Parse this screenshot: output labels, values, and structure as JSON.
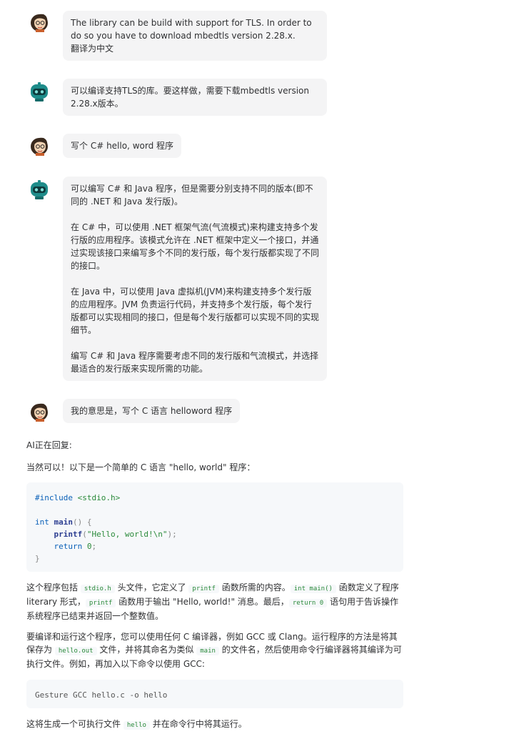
{
  "messages": [
    {
      "role": "user",
      "lines": [
        "The library can be build with support for TLS. In order to do so you have to download mbedtls version 2.28.x.",
        "翻译为中文"
      ]
    },
    {
      "role": "ai",
      "lines": [
        "可以编译支持TLS的库。要这样做，需要下载mbedtls version 2.28.x版本。"
      ]
    },
    {
      "role": "user",
      "lines": [
        "写个 C# hello, word 程序"
      ]
    },
    {
      "role": "ai",
      "paragraphs": [
        "可以编写 C# 和 Java 程序，但是需要分别支持不同的版本(即不同的 .NET 和 Java 发行版)。",
        "在 C# 中，可以使用 .NET 框架气流(气流模式)来构建支持多个发行版的应用程序。该模式允许在 .NET 框架中定义一个接口，并通过实现该接口来编写多个不同的发行版，每个发行版都实现了不同的接口。",
        "在 Java 中，可以使用 Java 虚拟机(JVM)来构建支持多个发行版的应用程序。JVM 负责运行代码，并支持多个发行版，每个发行版都可以实现相同的接口，但是每个发行版都可以实现不同的实现细节。",
        "编写 C# 和 Java 程序需要考虑不同的发行版和气流模式，并选择最适合的发行版来实现所需的功能。"
      ]
    },
    {
      "role": "user",
      "lines": [
        "我的意思是，写个 C 语言 helloword 程序"
      ]
    }
  ],
  "reply": {
    "status": "AI正在回复:",
    "intro": "当然可以！以下是一个简单的 C 语言 \"hello, world\" 程序：",
    "code": {
      "include_kw": "#include",
      "include_hdr": "<stdio.h>",
      "int_kw": "int",
      "main_fn": "main",
      "main_parens": "() {",
      "printf_fn": "printf",
      "printf_open": "(",
      "printf_str": "\"Hello, world!\\n\"",
      "printf_close": ");",
      "return_kw": "return",
      "return_val": "0",
      "semicolon": ";",
      "close_brace": "}"
    },
    "para1": {
      "t1": "这个程序包括 ",
      "c1": "stdio.h",
      "t2": " 头文件，它定义了 ",
      "c2": "printf",
      "t3": " 函数所需的内容。",
      "c3": "int main()",
      "t4": " 函数定义了程序 literary 形式，",
      "c4": "printf",
      "t5": " 函数用于输出 \"Hello, world!\" 消息。最后，",
      "c5": "return 0",
      "t6": " 语句用于告诉操作系统程序已结束并返回一个整数值。"
    },
    "para2": {
      "t1": "要编译和运行这个程序，您可以使用任何 C 编译器，例如 GCC 或 Clang。运行程序的方法是将其保存为 ",
      "c1": "hello.out",
      "t2": " 文件，并将其命名为类似 ",
      "c2": "main",
      "t3": " 的文件名，然后使用命令行编译器将其编译为可执行文件。例如，再加入以下命令以使用 GCC:"
    },
    "command": "Gesture GCC hello.c -o hello",
    "para3": {
      "t1": "这将生成一个可执行文件 ",
      "c1": "hello",
      "t2": " 并在命令行中将其运行。"
    }
  },
  "colors": {
    "bubble": "#f4f4f5",
    "code_bg": "#f6f8fa",
    "keyword": "#0b61b8",
    "string": "#2a8a3a"
  },
  "icons": {
    "user": "user-avatar-icon",
    "ai": "robot-avatar-icon"
  }
}
